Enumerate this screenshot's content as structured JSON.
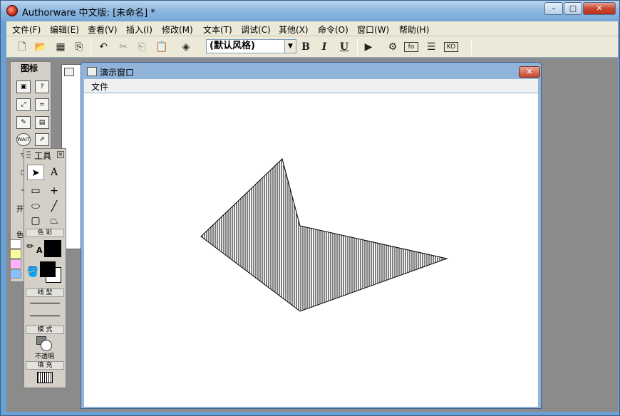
{
  "window": {
    "title": "Authorware 中文版: [未命名] *",
    "caption_min": "–",
    "caption_max": "□",
    "caption_close": "✕"
  },
  "menubar": {
    "items": [
      {
        "label": "文件(F)"
      },
      {
        "label": "编辑(E)"
      },
      {
        "label": "查看(V)"
      },
      {
        "label": "插入(I)"
      },
      {
        "label": "修改(M)"
      },
      {
        "label": "文本(T)"
      },
      {
        "label": "调试(C)"
      },
      {
        "label": "其他(X)"
      },
      {
        "label": "命令(O)"
      },
      {
        "label": "窗口(W)"
      },
      {
        "label": "帮助(H)"
      }
    ]
  },
  "toolbar": {
    "style_value": "(默认风格)",
    "bold": "B",
    "italic": "I",
    "underline": "U"
  },
  "icon_palette": {
    "title": "图标",
    "partial_labels": [
      "开",
      "色"
    ]
  },
  "presentation_window": {
    "title": "演示窗口",
    "menu_file": "文件",
    "close": "✕"
  },
  "tools_palette": {
    "title": "工具",
    "text_tool": "A",
    "text_label": "A",
    "sections": {
      "color": "色 彩",
      "line": "线 型",
      "mode": "模 式",
      "mode_value": "不透明",
      "fill": "填 充"
    }
  },
  "canvas_shape": {
    "fill_pattern": "vertical-lines",
    "stroke_color": "#000000"
  },
  "colors": {
    "title_blue": "#8bb6e0",
    "close_red": "#c8462c",
    "workspace_gray": "#8b8b8b",
    "palette_gray": "#d4d0c8"
  }
}
